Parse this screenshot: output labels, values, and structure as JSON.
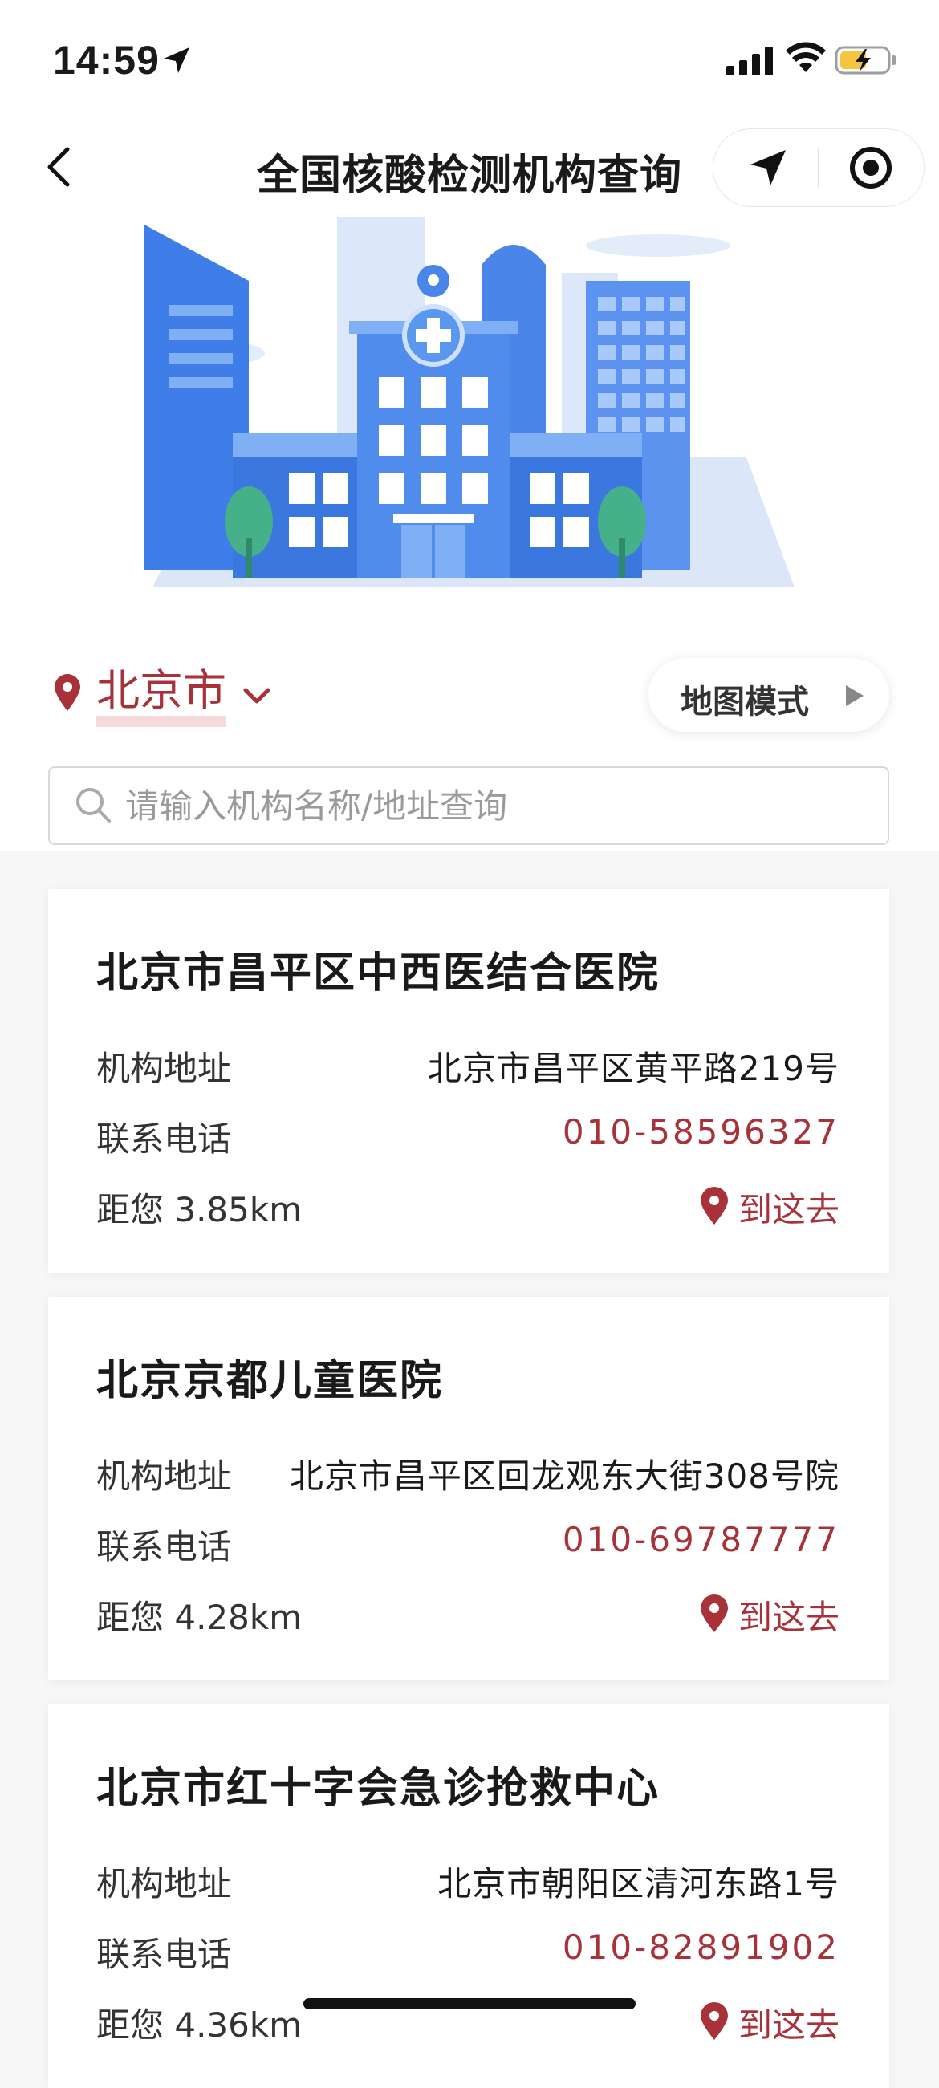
{
  "status_bar": {
    "time": "14:59"
  },
  "nav": {
    "title": "全国核酸检测机构查询"
  },
  "city": {
    "name": "北京市"
  },
  "map_mode": {
    "label": "地图模式"
  },
  "search": {
    "placeholder": "请输入机构名称/地址查询",
    "value": ""
  },
  "labels": {
    "address": "机构地址",
    "phone": "联系电话",
    "go": "到这去"
  },
  "institutions": [
    {
      "name": "北京市昌平区中西医结合医院",
      "address": "北京市昌平区黄平路219号",
      "phone": "010-58596327",
      "distance": "距您 3.85km"
    },
    {
      "name": "北京京都儿童医院",
      "address": "北京市昌平区回龙观东大街308号院",
      "phone": "010-69787777",
      "distance": "距您 4.28km"
    },
    {
      "name": "北京市红十字会急诊抢救中心",
      "address": "北京市朝阳区清河东路1号",
      "phone": "010-82891902",
      "distance": "距您 4.36km"
    }
  ],
  "colors": {
    "accent": "#a8323a",
    "illustration_blue": "#4a86e8"
  },
  "icons": [
    "location-arrow-icon",
    "signal-icon",
    "wifi-icon",
    "battery-charging-icon",
    "back-icon",
    "navigate-icon",
    "target-icon",
    "map-pin-icon",
    "chevron-down-icon",
    "play-triangle-icon",
    "search-icon"
  ]
}
